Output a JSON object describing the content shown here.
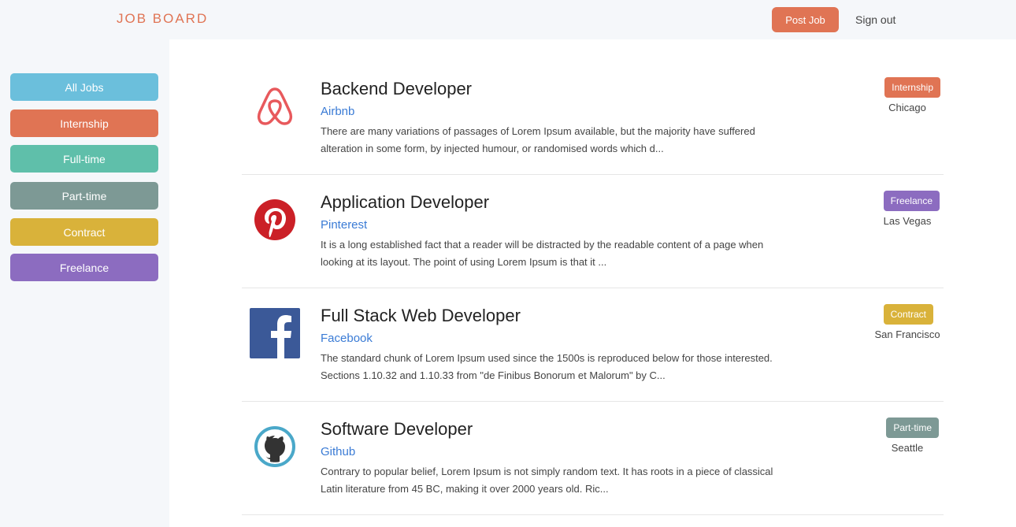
{
  "header": {
    "brand": "JOB BOARD",
    "post_job_label": "Post Job",
    "sign_out_label": "Sign out"
  },
  "sidebar": {
    "items": [
      {
        "label": "All Jobs",
        "color": "#6bbfdc"
      },
      {
        "label": "Internship",
        "color": "#e07454"
      },
      {
        "label": "Full-time",
        "color": "#5fbfaa"
      },
      {
        "label": "Part-time",
        "color": "#7d9995"
      },
      {
        "label": "Contract",
        "color": "#d9b23a"
      },
      {
        "label": "Freelance",
        "color": "#8c6cc0"
      }
    ]
  },
  "jobs": [
    {
      "title": "Backend Developer",
      "company": "Airbnb",
      "logo": "airbnb-logo",
      "description": "There are many variations of passages of Lorem Ipsum available, but the majority have suffered alteration in some form, by injected humour, or randomised words which d...",
      "type": "Internship",
      "type_color": "#e07454",
      "location": "Chicago"
    },
    {
      "title": "Application Developer",
      "company": "Pinterest",
      "logo": "pinterest-logo",
      "description": "It is a long established fact that a reader will be distracted by the readable content of a page when looking at its layout. The point of using Lorem Ipsum is that it ...",
      "type": "Freelance",
      "type_color": "#8c6cc0",
      "location": "Las Vegas"
    },
    {
      "title": "Full Stack Web Developer",
      "company": "Facebook",
      "logo": "facebook-logo",
      "description": "The standard chunk of Lorem Ipsum used since the 1500s is reproduced below for those interested. Sections 1.10.32 and 1.10.33 from \"de Finibus Bonorum et Malorum\" by C...",
      "type": "Contract",
      "type_color": "#d9b23a",
      "location": "San Francisco"
    },
    {
      "title": "Software Developer",
      "company": "Github",
      "logo": "github-logo",
      "description": "Contrary to popular belief, Lorem Ipsum is not simply random text. It has roots in a piece of classical Latin literature from 45 BC, making it over 2000 years old. Ric...",
      "type": "Part-time",
      "type_color": "#7d9995",
      "location": "Seattle"
    }
  ]
}
